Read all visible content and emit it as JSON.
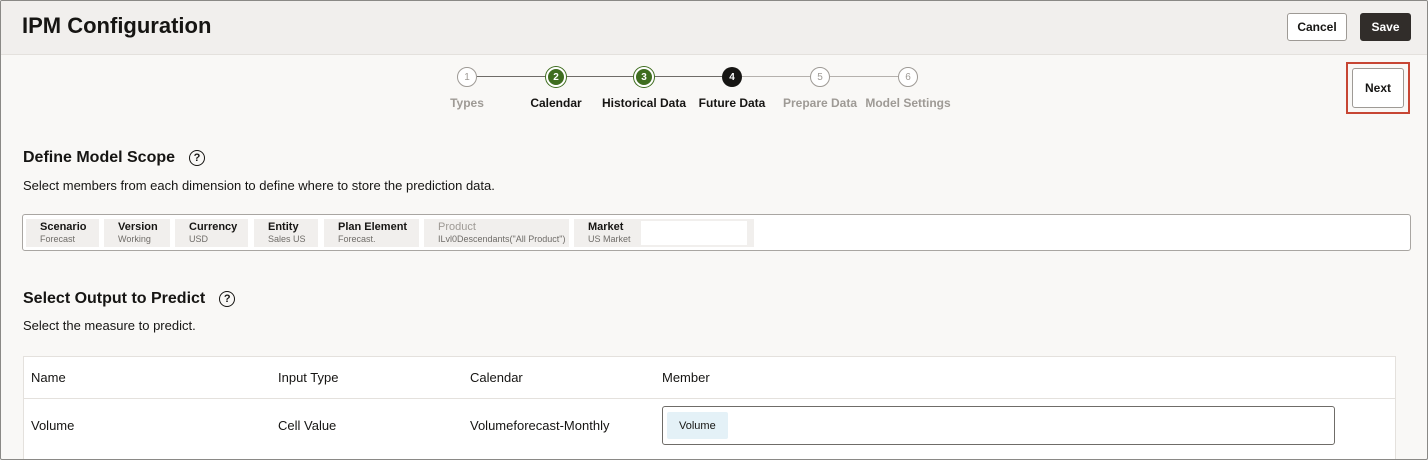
{
  "header": {
    "title": "IPM Configuration",
    "cancel_label": "Cancel",
    "save_label": "Save",
    "next_label": "Next"
  },
  "train": {
    "steps": [
      {
        "number": "1",
        "label": "Types",
        "state": "future"
      },
      {
        "number": "2",
        "label": "Calendar",
        "state": "done"
      },
      {
        "number": "3",
        "label": "Historical Data",
        "state": "done"
      },
      {
        "number": "4",
        "label": "Future Data",
        "state": "current"
      },
      {
        "number": "5",
        "label": "Prepare Data",
        "state": "future"
      },
      {
        "number": "6",
        "label": "Model Settings",
        "state": "future"
      }
    ]
  },
  "scope": {
    "title": "Define Model Scope",
    "help": "?",
    "description": "Select members from each dimension to define where to store the prediction data.",
    "pov": [
      {
        "dimension": "Scenario",
        "member": "Forecast"
      },
      {
        "dimension": "Version",
        "member": "Working"
      },
      {
        "dimension": "Currency",
        "member": "USD"
      },
      {
        "dimension": "Entity",
        "member": "Sales US"
      },
      {
        "dimension": "Plan Element",
        "member": "Forecast."
      },
      {
        "dimension": "Product",
        "member": "ILvl0Descendants(\"All Product\")"
      },
      {
        "dimension": "Market",
        "member": "US Market"
      }
    ]
  },
  "output": {
    "title": "Select Output to Predict",
    "help": "?",
    "description": "Select the measure to predict.",
    "columns": [
      "Name",
      "Input Type",
      "Calendar",
      "Member"
    ],
    "rows": [
      {
        "name": "Volume",
        "input_type": "Cell Value",
        "calendar": "Volumeforecast-Monthly",
        "member": "Volume"
      }
    ]
  },
  "colors": {
    "done": "#3f6d1f",
    "current": "#161513",
    "highlight": "#c74634",
    "save_bg": "#312d2a"
  }
}
